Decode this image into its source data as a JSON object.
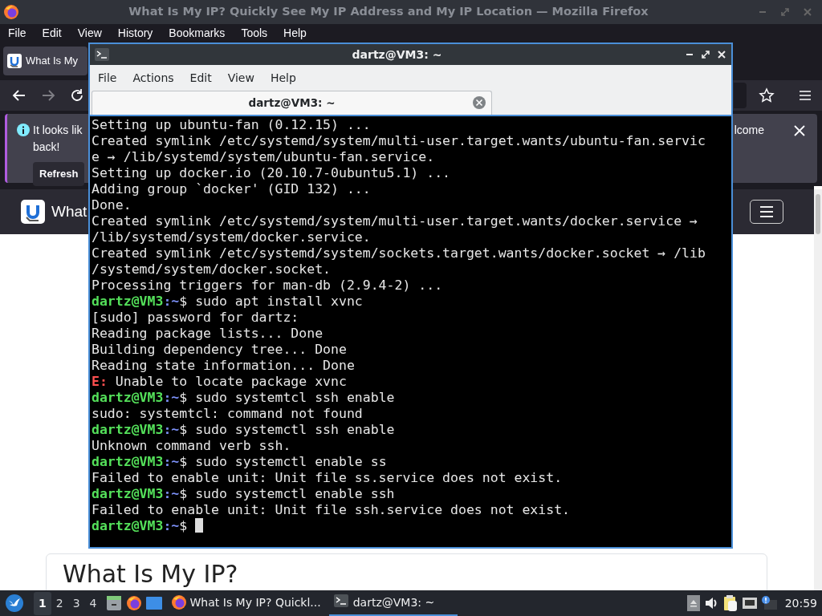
{
  "firefox": {
    "title": "What Is My IP? Quickly See My IP Address and My IP Location — Mozilla Firefox",
    "menu": [
      "File",
      "Edit",
      "View",
      "History",
      "Bookmarks",
      "Tools",
      "Help"
    ],
    "tab": {
      "label": "What Is My"
    },
    "nav": {
      "forward_disabled": true
    },
    "notification": {
      "text_start": "It looks lik",
      "text_start_2": "back!",
      "text_end": "lcome",
      "button": "Refresh"
    },
    "site_header": {
      "brand": "What"
    },
    "page": {
      "heading": "What Is My IP?"
    }
  },
  "terminal": {
    "title": "dartz@VM3: ~",
    "menu": [
      "File",
      "Actions",
      "Edit",
      "View",
      "Help"
    ],
    "tab": {
      "label": "dartz@VM3: ~"
    },
    "lines": [
      {
        "text": "Setting up ubuntu-fan (0.12.15) ..."
      },
      {
        "text": "Created symlink /etc/systemd/system/multi-user.target.wants/ubuntu-fan.servic"
      },
      {
        "text": "e → /lib/systemd/system/ubuntu-fan.service."
      },
      {
        "text": "Setting up docker.io (20.10.7-0ubuntu5.1) ..."
      },
      {
        "text": "Adding group `docker' (GID 132) ..."
      },
      {
        "text": "Done."
      },
      {
        "text": "Created symlink /etc/systemd/system/multi-user.target.wants/docker.service →"
      },
      {
        "text": "/lib/systemd/system/docker.service."
      },
      {
        "text": "Created symlink /etc/systemd/system/sockets.target.wants/docker.socket → /lib"
      },
      {
        "text": "/systemd/system/docker.socket."
      },
      {
        "text": "Processing triggers for man-db (2.9.4-2) ..."
      },
      {
        "segments": [
          {
            "text": "dartz@VM3",
            "kind": "user"
          },
          {
            "text": ":~",
            "kind": "path"
          },
          {
            "text": "$ sudo apt install xvnc",
            "kind": "plain"
          }
        ]
      },
      {
        "text": "[sudo] password for dartz:"
      },
      {
        "text": "Reading package lists... Done"
      },
      {
        "text": "Building dependency tree... Done"
      },
      {
        "text": "Reading state information... Done"
      },
      {
        "segments": [
          {
            "text": "E:",
            "kind": "error"
          },
          {
            "text": " Unable to locate package xvnc",
            "kind": "plain"
          }
        ]
      },
      {
        "segments": [
          {
            "text": "dartz@VM3",
            "kind": "user"
          },
          {
            "text": ":~",
            "kind": "path"
          },
          {
            "text": "$ sudo systemtcl ssh enable",
            "kind": "plain"
          }
        ]
      },
      {
        "text": "sudo: systemtcl: command not found"
      },
      {
        "segments": [
          {
            "text": "dartz@VM3",
            "kind": "user"
          },
          {
            "text": ":~",
            "kind": "path"
          },
          {
            "text": "$ sudo systemctl ssh enable",
            "kind": "plain"
          }
        ]
      },
      {
        "text": "Unknown command verb ssh."
      },
      {
        "segments": [
          {
            "text": "dartz@VM3",
            "kind": "user"
          },
          {
            "text": ":~",
            "kind": "path"
          },
          {
            "text": "$ sudo systemctl enable ss",
            "kind": "plain"
          }
        ]
      },
      {
        "text": "Failed to enable unit: Unit file ss.service does not exist."
      },
      {
        "segments": [
          {
            "text": "dartz@VM3",
            "kind": "user"
          },
          {
            "text": ":~",
            "kind": "path"
          },
          {
            "text": "$ sudo systemctl enable ssh",
            "kind": "plain"
          }
        ]
      },
      {
        "text": "Failed to enable unit: Unit file ssh.service does not exist."
      },
      {
        "segments": [
          {
            "text": "dartz@VM3",
            "kind": "user"
          },
          {
            "text": ":~",
            "kind": "path"
          },
          {
            "text": "$",
            "kind": "plain"
          }
        ],
        "cursor": true
      }
    ]
  },
  "taskbar": {
    "workspaces": [
      {
        "label": "1",
        "selected": true
      },
      {
        "label": "2",
        "selected": false
      },
      {
        "label": "3",
        "selected": false
      },
      {
        "label": "4",
        "selected": false
      }
    ],
    "tasks": [
      {
        "label": "What Is My IP? Quickl...",
        "kind": "browser",
        "selected": false
      },
      {
        "label": "dartz@VM3: ~",
        "kind": "terminal",
        "selected": true
      }
    ],
    "clock": "20:59"
  }
}
